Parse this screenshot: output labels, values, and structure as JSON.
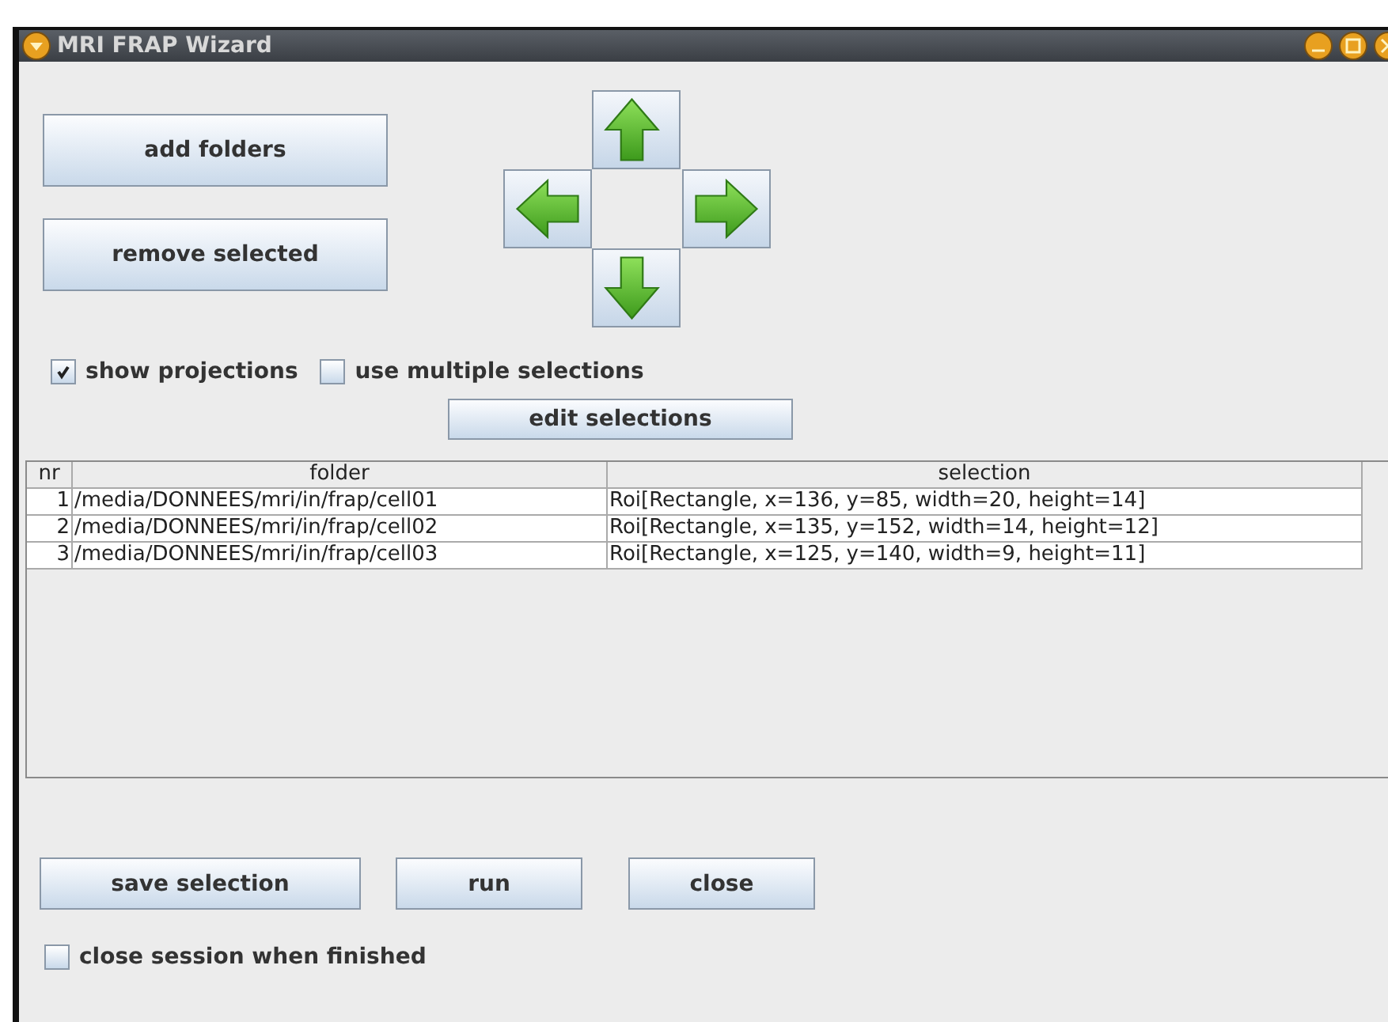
{
  "window": {
    "title": "MRI FRAP Wizard"
  },
  "top_buttons": [
    "add folders",
    "remove selected"
  ],
  "arrows": [
    {
      "kind": "up"
    },
    {
      "kind": "left"
    },
    {
      "kind": "right"
    },
    {
      "kind": "down"
    }
  ],
  "options": [
    {
      "label": "show projections",
      "checked": true
    },
    {
      "label": "use multiple selections",
      "checked": false
    }
  ],
  "edit_button": "edit selections",
  "table": {
    "columns": [
      "nr",
      "folder",
      "selection"
    ],
    "rows": [
      [
        "1",
        "/media/DONNEES/mri/in/frap/cell01",
        "Roi[Rectangle, x=136, y=85, width=20, height=14]"
      ],
      [
        "2",
        "/media/DONNEES/mri/in/frap/cell02",
        "Roi[Rectangle, x=135, y=152, width=14, height=12]"
      ],
      [
        "3",
        "/media/DONNEES/mri/in/frap/cell03",
        "Roi[Rectangle, x=125, y=140, width=9, height=11]"
      ]
    ]
  },
  "bottom_buttons": [
    "save selection",
    "run",
    "close"
  ],
  "finish_option": {
    "label": "close session when finished",
    "checked": false
  }
}
